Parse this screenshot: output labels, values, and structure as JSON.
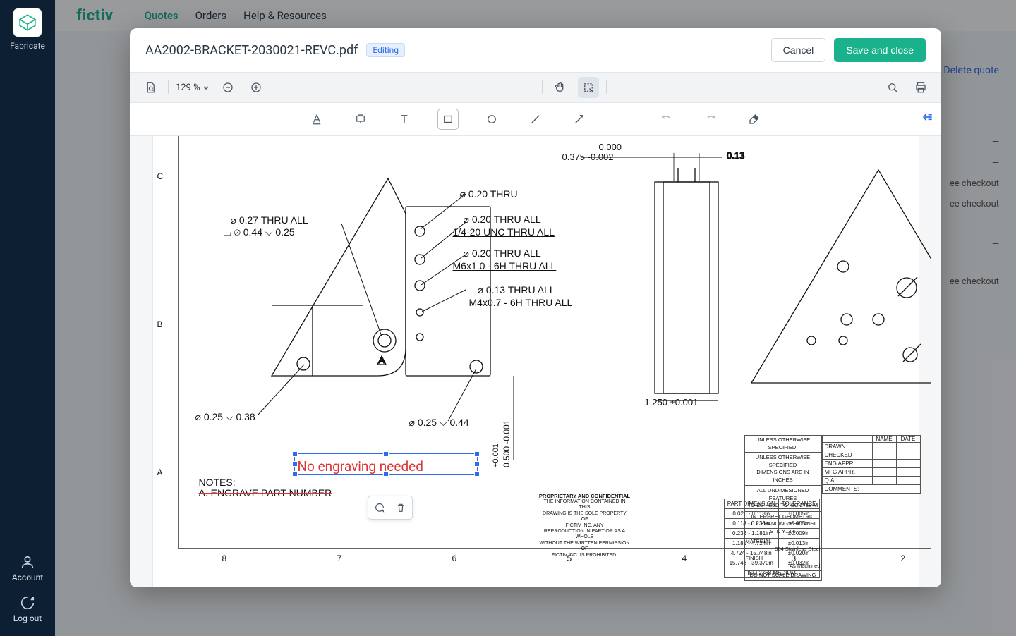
{
  "leftbar": {
    "brand": "Fabricate",
    "account": "Account",
    "logout": "Log out"
  },
  "topnav": {
    "logo": "fictiv",
    "quotes": "Quotes",
    "orders": "Orders",
    "help": "Help & Resources"
  },
  "backdrop": {
    "delete": "Delete quote",
    "checkout1": "ee checkout",
    "checkout2": "ee checkout",
    "checkout3": "ee checkout",
    "dash1": "—",
    "dash2": "—",
    "dash3": "—"
  },
  "modal": {
    "title": "AA2002-BRACKET-2030021-REVC.pdf",
    "badge": "Editing",
    "cancel": "Cancel",
    "save": "Save and close",
    "zoom": "129 %"
  },
  "drawing": {
    "row_c": "C",
    "row_b": "B",
    "row_a": "A",
    "col_8": "8",
    "col_7": "7",
    "col_6": "6",
    "col_5": "5",
    "col_4": "4",
    "col_3": "3",
    "col_2": "2",
    "dim_top1": "0.000",
    "dim_top2": "0.375 -0.002",
    "dim_013": "0.13",
    "call_thru": "⌀ 0.20 THRU",
    "call_027": "⌀  0.27 THRU ALL",
    "call_044": "⌀  0.44  ⌵  0.25",
    "raw_cbore": "⌴",
    "call_020all": "⌀  0.20 THRU  ALL",
    "call_14_20": "1/4-20 UNC  THRU ALL",
    "call_020_2": "⌀  0.20 THRU  ALL",
    "call_m6": "M6x1.0 - 6H THRU ALL",
    "call_013": "⌀  0.13 THRU  ALL",
    "call_m4": "M4x0.7 - 6H THRU  ALL",
    "call_025_038": "⌀ 0.25 ⌵ 0.38",
    "call_025_044": "⌀ 0.25 ⌵ 0.44",
    "datum_a": "A",
    "side_dim": "1.250 ±0.001",
    "vert_dim": "0.500 -0.001",
    "vert_tol": "+0.001",
    "notes": "NOTES:",
    "note_a": "A.   ENGRAVE PART NUMBER",
    "annotation": "No engraving needed",
    "proprietary_h": "PROPRIETARY AND CONFIDENTIAL",
    "proprietary_1": "THE INFORMATION CONTAINED IN THIS",
    "proprietary_2": "DRAWING IS THE SOLE PROPERTY OF",
    "proprietary_3": "FICTIV INC.  ANY",
    "proprietary_4": "REPRODUCTION IN PART OR AS A WHOLE",
    "proprietary_5": "WITHOUT THE WRITTEN PERMISSION OF",
    "proprietary_6": "FICTIV INC. IS PROHIBITED.",
    "tol_h1": "PART DIMENSION",
    "tol_h2": "TOLERANCE",
    "tol_r1a": "0.020 - 0.118in",
    "tol_r1b": "±0.005in",
    "tol_r2a": "0.118 - 0.236in",
    "tol_r2b": "±0.005in",
    "tol_r3a": "0.236 - 1.181in",
    "tol_r3b": "±0.009in",
    "tol_r4a": "1.181 - 4.724in",
    "tol_r4b": "±0.013in",
    "tol_r5a": "4.724 - 15.748in",
    "tol_r5b": "±0.020in",
    "tol_r6a": "15.748 - 39.370in",
    "tol_r6b": "±0.032in",
    "tol_foot": "ISO 2768 MEDIUM",
    "spec_h": "UNLESS OTHERWISE SPECIFIED:",
    "spec_1": "UNLESS OTHERWISE SPECIFIED",
    "spec_2": "DIMENSIONS ARE IN INCHES",
    "spec_3": "ALL UNDIMESIONED FEATURES",
    "spec_4": "TO BE HELD TO ISO 2768-M",
    "spec_5": "INTERPRET GEOMETRIC",
    "spec_6": "TOLERANCING PER: ANSI STD Y14.5",
    "mat_h": "MATERIAL",
    "mat_v": "304 Stainless Steel",
    "fin_h": "FINISH",
    "fin_v": "As Machined",
    "dns": "DO NOT SCALE DRAWING",
    "rev_drawn": "DRAWN",
    "rev_checked": "CHECKED",
    "rev_eng": "ENG APPR.",
    "rev_mfg": "MFG APPR.",
    "rev_qa": "Q.A.",
    "rev_comments": "COMMENTS:",
    "col_name": "NAME",
    "col_date": "DATE"
  }
}
